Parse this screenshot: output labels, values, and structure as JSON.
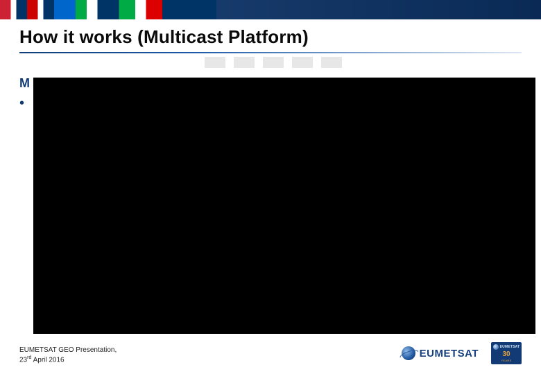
{
  "slide": {
    "title": "How it works (Multicast Platform)",
    "section_label_first_char": "M",
    "bullet_marker": "•"
  },
  "footer": {
    "line1": "EUMETSAT GEO Presentation,",
    "date_pre": "23",
    "date_ord": "rd",
    "date_post": " April 2016"
  },
  "logo": {
    "wordmark": "EUMETSAT",
    "badge_brand": "EUMETSAT",
    "badge_number": "30",
    "badge_sub": "YEARS"
  }
}
